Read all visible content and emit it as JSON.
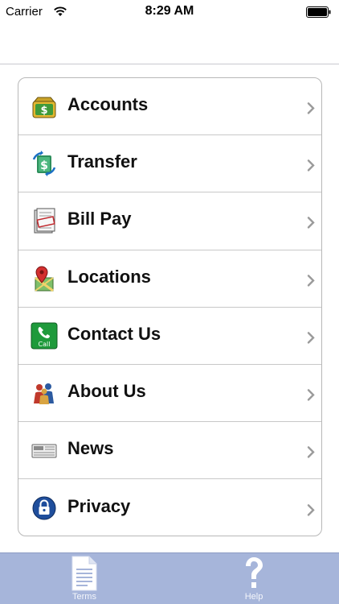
{
  "status_bar": {
    "carrier": "Carrier",
    "time": "8:29 AM"
  },
  "menu": {
    "items": [
      {
        "label": "Accounts",
        "icon": "money-bag-icon"
      },
      {
        "label": "Transfer",
        "icon": "transfer-icon"
      },
      {
        "label": "Bill Pay",
        "icon": "paid-bill-icon"
      },
      {
        "label": "Locations",
        "icon": "map-pin-icon"
      },
      {
        "label": "Contact Us",
        "icon": "call-icon",
        "icon_text": "Call"
      },
      {
        "label": "About Us",
        "icon": "people-icon"
      },
      {
        "label": "News",
        "icon": "newspaper-icon"
      },
      {
        "label": "Privacy",
        "icon": "lock-icon"
      }
    ]
  },
  "tab_bar": {
    "terms_label": "Terms",
    "help_label": "Help"
  },
  "colors": {
    "tab_bar_bg": "#a6b5da",
    "card_border": "#b8b8b8",
    "chevron": "#9a9a9a"
  }
}
